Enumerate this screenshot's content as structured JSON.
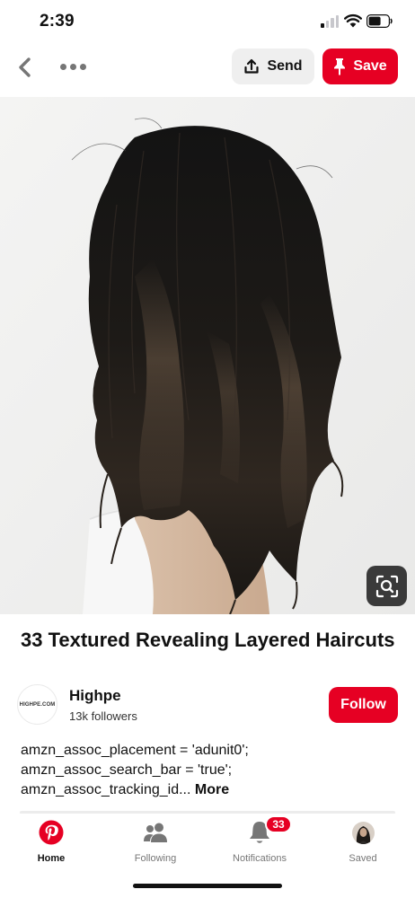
{
  "status_bar": {
    "time": "2:39"
  },
  "header": {
    "send_label": "Send",
    "save_label": "Save",
    "icons": [
      "chevron-left-icon",
      "more-icon",
      "share-icon",
      "pin-icon"
    ]
  },
  "pin": {
    "title": "33 Textured Revealing Layered Haircuts",
    "description_lines": [
      "amzn_assoc_placement = 'adunit0';",
      "amzn_assoc_search_bar = 'true';",
      "amzn_assoc_tracking_id..."
    ],
    "more_label": "More"
  },
  "creator": {
    "avatar_text": "HIGHPE.COM",
    "name": "Highpe",
    "followers": "13k followers",
    "follow_label": "Follow"
  },
  "tabbar": {
    "tabs": [
      {
        "label": "Home",
        "icon": "pinterest-logo-icon",
        "active": true
      },
      {
        "label": "Following",
        "icon": "people-icon",
        "active": false
      },
      {
        "label": "Notifications",
        "icon": "bell-icon",
        "active": false
      },
      {
        "label": "Saved",
        "icon": "profile-avatar",
        "active": false
      }
    ],
    "notifications_badge": "33"
  },
  "colors": {
    "brand_red": "#e60023",
    "send_button_bg": "#efefef",
    "lens_button_bg": "#3a3a3a"
  }
}
